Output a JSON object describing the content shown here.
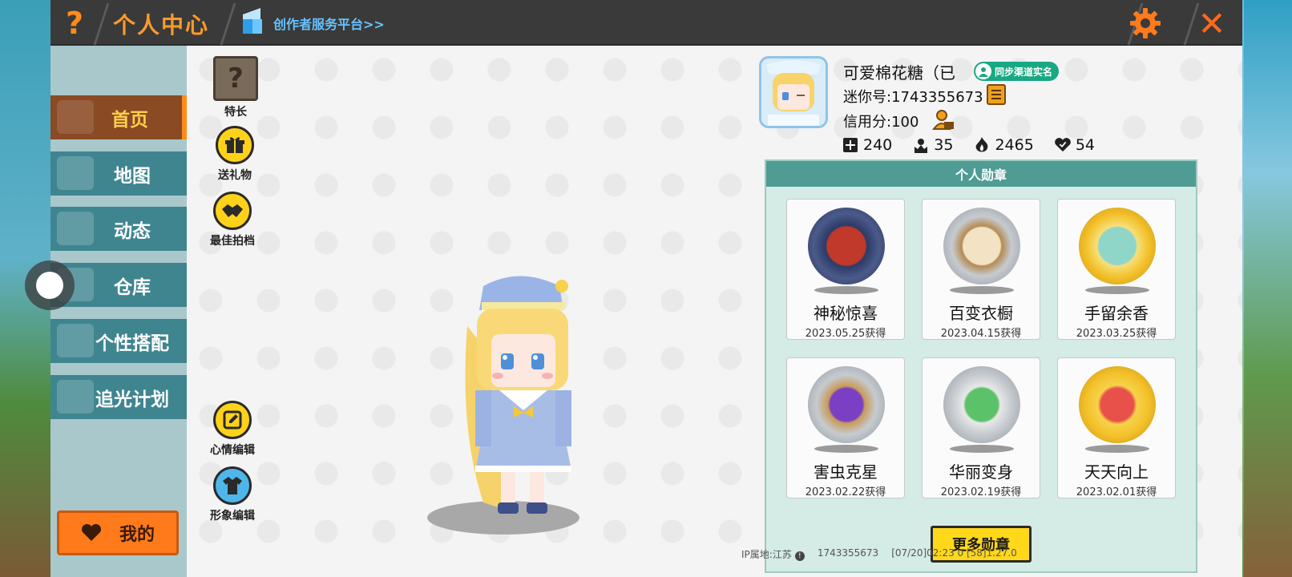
{
  "header": {
    "help_label": "?",
    "title": "个人中心",
    "creator_link": "创作者服务平台>>",
    "close_label": "✕"
  },
  "sidebar": {
    "items": [
      {
        "label": "首页"
      },
      {
        "label": "地图"
      },
      {
        "label": "动态"
      },
      {
        "label": "仓库"
      },
      {
        "label": "个性搭配"
      },
      {
        "label": "追光计划"
      }
    ],
    "mine_label": "我的"
  },
  "actions": {
    "talent": "特长",
    "gift": "送礼物",
    "partner": "最佳拍档",
    "mood_edit": "心情编辑",
    "image_edit": "形象编辑"
  },
  "profile": {
    "nickname": "可爱棉花糖（已",
    "verify_badge": "同步渠道实名",
    "mini_id": "迷你号:1743355673",
    "credit": "信用分:100",
    "stats": {
      "friends": "240",
      "followers": "35",
      "heat": "2465",
      "likes": "54"
    }
  },
  "medals": {
    "title": "个人勋章",
    "items": [
      {
        "name": "神秘惊喜",
        "date": "2023.05.25获得",
        "color": "#4a5a8a"
      },
      {
        "name": "百变衣橱",
        "date": "2023.04.15获得",
        "color": "#9aa0a6"
      },
      {
        "name": "手留余香",
        "date": "2023.03.25获得",
        "color": "#f0b820"
      },
      {
        "name": "害虫克星",
        "date": "2023.02.22获得",
        "color": "#9aa0a6"
      },
      {
        "name": "华丽变身",
        "date": "2023.02.19获得",
        "color": "#9aa0a6"
      },
      {
        "name": "天天向上",
        "date": "2023.02.01获得",
        "color": "#f0b820"
      }
    ],
    "more_label": "更多勋章"
  },
  "footer": {
    "ip_location": "IP属地:江苏",
    "uid": "1743355673",
    "build": "[07/20]02:23 0  [58]1.27.0"
  },
  "colors": {
    "accent": "#ff8c1a",
    "sidebar": "#3f8590",
    "active": "#8a4a24",
    "medal_header": "#4f9c94"
  }
}
